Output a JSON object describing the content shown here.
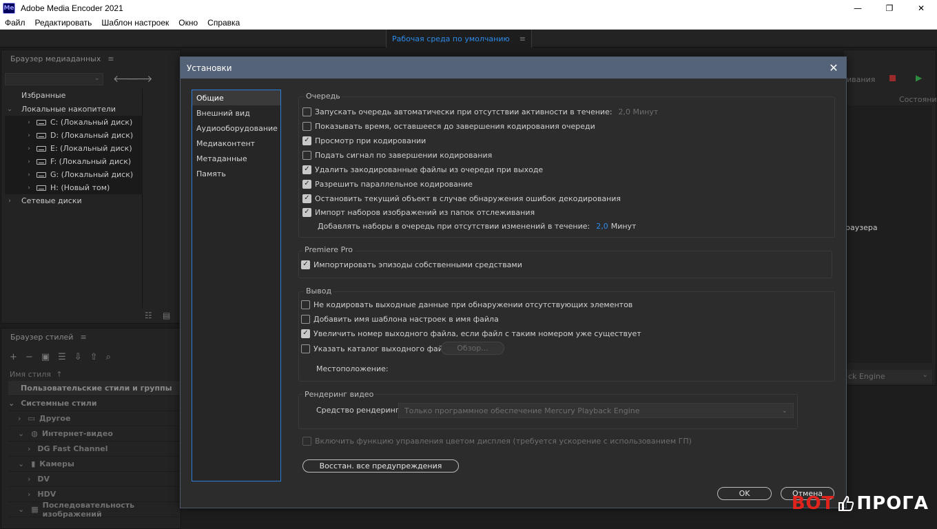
{
  "window": {
    "icon_text": "Me",
    "title": "Adobe Media Encoder 2021",
    "minimize": "—",
    "maximize": "❐",
    "close": "✕"
  },
  "menu": [
    "Файл",
    "Редактировать",
    "Шаблон настроек",
    "Окно",
    "Справка"
  ],
  "workspace": {
    "label": "Рабочая среда по умолчанию",
    "menu_glyph": "≡"
  },
  "media_browser": {
    "title": "Браузер медиаданных",
    "menu_glyph": "≡",
    "tree": [
      {
        "label": "Избранные",
        "indent": 0,
        "chev": ""
      },
      {
        "label": "Локальные накопители",
        "indent": 0,
        "chev": "⌄"
      },
      {
        "label": "C: (Локальный диск)",
        "indent": 1,
        "chev": "›"
      },
      {
        "label": "D: (Локальный диск)",
        "indent": 1,
        "chev": "›"
      },
      {
        "label": "E: (Локальный диск)",
        "indent": 1,
        "chev": "›"
      },
      {
        "label": "F: (Локальный диск)",
        "indent": 1,
        "chev": "›"
      },
      {
        "label": "G: (Локальный диск)",
        "indent": 1,
        "chev": "›"
      },
      {
        "label": "H: (Новый том)",
        "indent": 1,
        "chev": "›"
      },
      {
        "label": "Сетевые диски",
        "indent": 0,
        "chev": "›"
      }
    ]
  },
  "style_browser": {
    "title": "Браузер стилей",
    "menu_glyph": "≡",
    "column_header": "Имя стиля",
    "rows": [
      {
        "label": "Пользовательские стили и группы"
      },
      {
        "label": "Системные стили"
      },
      {
        "label": "Другое"
      },
      {
        "label": "Интернет-видео"
      },
      {
        "label": "DG Fast Channel"
      },
      {
        "label": "Камеры"
      },
      {
        "label": "DV"
      },
      {
        "label": "HDV"
      },
      {
        "label": "Последовательность изображений"
      }
    ]
  },
  "right_panel": {
    "tail_text_1": "ивания",
    "status_header": "Состояни",
    "tail_text_2": "раузера",
    "engine_tail": "ck Engine"
  },
  "dialog": {
    "title": "Установки",
    "close": "✕",
    "categories": [
      "Общие",
      "Внешний вид",
      "Аудиооборудование",
      "Медиаконтент",
      "Метаданные",
      "Память"
    ],
    "selected_category": "Общие",
    "queue": {
      "title": "Очередь",
      "items": [
        {
          "label": "Запускать очередь автоматически при отсутствии активности в течение:",
          "checked": false,
          "suffix": "2,0 Минут"
        },
        {
          "label": "Показывать время, оставшееся до завершения кодирования очереди",
          "checked": false
        },
        {
          "label": "Просмотр при кодировании",
          "checked": true
        },
        {
          "label": "Подать сигнал по завершении кодирования",
          "checked": false
        },
        {
          "label": "Удалить закодированные файлы из очереди при выходе",
          "checked": true
        },
        {
          "label": "Разрешить параллельное кодирование",
          "checked": true
        },
        {
          "label": "Остановить текущий объект в случае обнаружения ошибок декодирования",
          "checked": true
        },
        {
          "label": "Импорт наборов изображений из папок отслеживания",
          "checked": true
        }
      ],
      "watch_folder_label": "Добавлять наборы в очередь при отсутствии изменений в течение:",
      "watch_folder_value": "2,0",
      "watch_folder_unit": "Минут"
    },
    "premiere": {
      "title": "Premiere Pro",
      "items": [
        {
          "label": "Импортировать эпизоды собственными средствами",
          "checked": true
        }
      ]
    },
    "output": {
      "title": "Вывод",
      "items": [
        {
          "label": "Не кодировать выходные данные при обнаружении отсутствующих элементов",
          "checked": false
        },
        {
          "label": "Добавить имя шаблона настроек в имя файла",
          "checked": false
        },
        {
          "label": "Увеличить номер выходного файла, если файл с таким номером уже существует",
          "checked": true
        },
        {
          "label": "Указать каталог выходного файла:",
          "checked": false
        }
      ],
      "browse_button": "Обзор...",
      "location_label": "Местоположение:"
    },
    "render": {
      "title": "Рендеринг видео",
      "renderer_label": "Средство рендеринга:",
      "renderer_value": "Только программное обеспечение Mercury Playback Engine"
    },
    "color_mgmt": {
      "label": "Включить функцию управления цветом дисплея (требуется ускорение с использованием ГП)",
      "checked": false
    },
    "reset_warnings": "Восстан. все предупреждения",
    "ok": "OK",
    "cancel": "Отмена"
  },
  "watermark": {
    "left": "ВОТ",
    "right": "ПРОГА"
  },
  "colors": {
    "accent": "#2d8ceb",
    "dialog_title_bg": "#546378",
    "panel_bg": "#232323",
    "dialog_bg": "#2c2c2c"
  }
}
